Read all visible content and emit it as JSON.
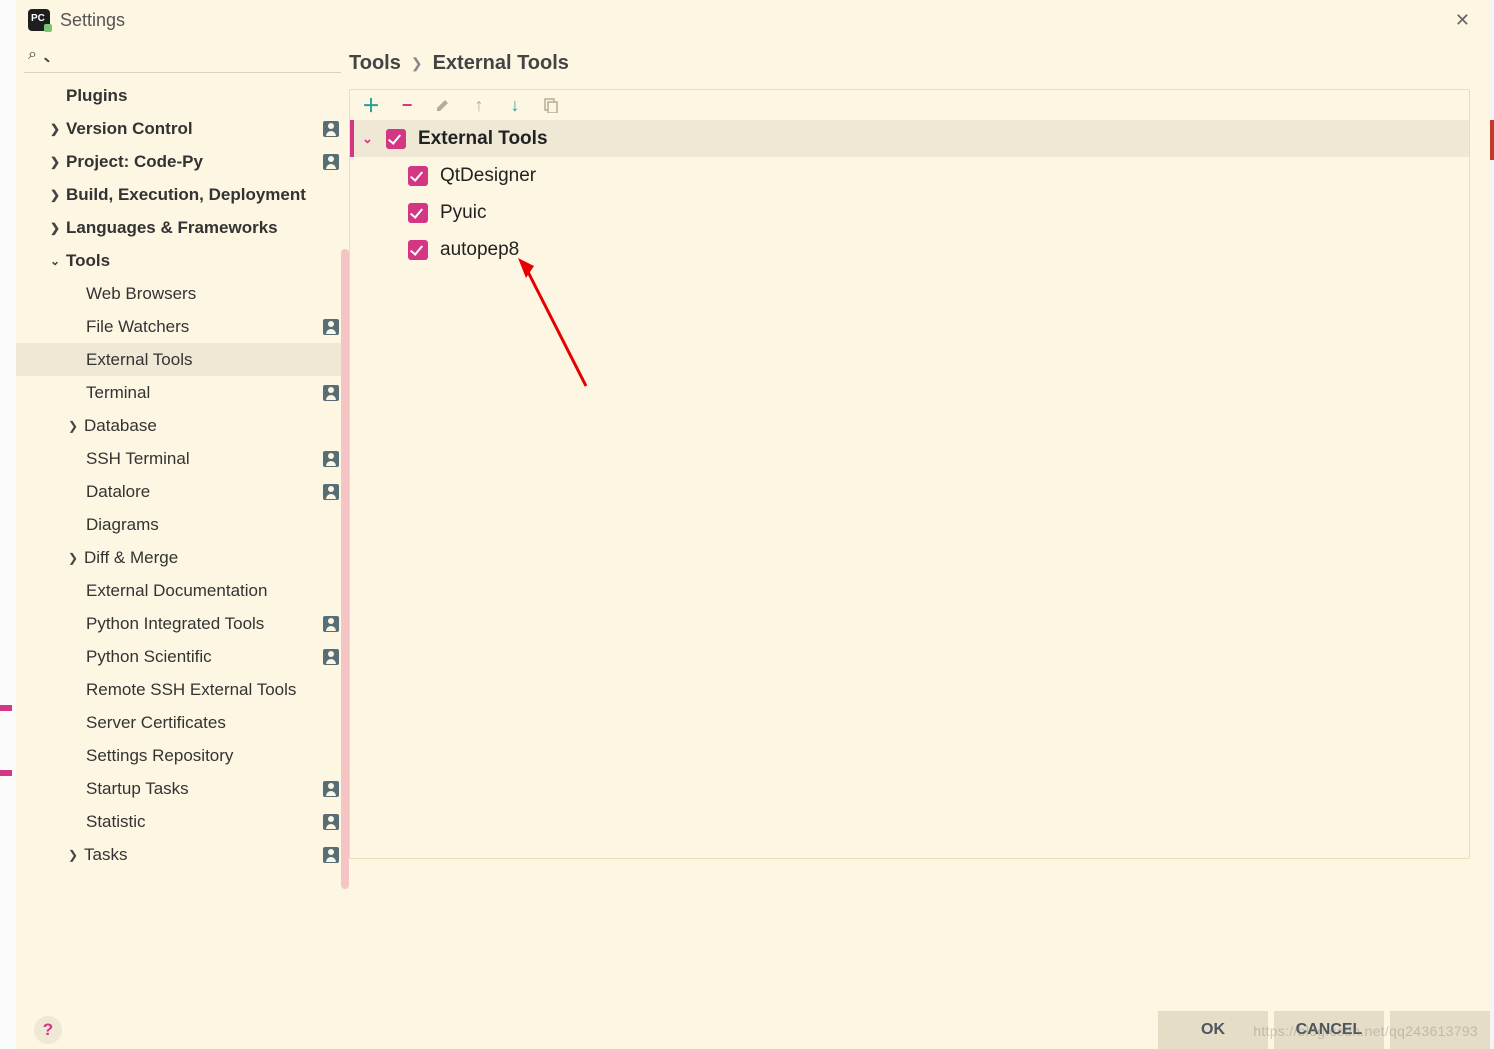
{
  "window": {
    "title": "Settings"
  },
  "breadcrumb": {
    "a": "Tools",
    "b": "External Tools"
  },
  "sidebar": {
    "items": [
      {
        "label": "Plugins"
      },
      {
        "label": "Version Control"
      },
      {
        "label": "Project: Code-Py"
      },
      {
        "label": "Build, Execution, Deployment"
      },
      {
        "label": "Languages & Frameworks"
      },
      {
        "label": "Tools"
      },
      {
        "label": "Web Browsers"
      },
      {
        "label": "File Watchers"
      },
      {
        "label": "External Tools"
      },
      {
        "label": "Terminal"
      },
      {
        "label": "Database"
      },
      {
        "label": "SSH Terminal"
      },
      {
        "label": "Datalore"
      },
      {
        "label": "Diagrams"
      },
      {
        "label": "Diff & Merge"
      },
      {
        "label": "External Documentation"
      },
      {
        "label": "Python Integrated Tools"
      },
      {
        "label": "Python Scientific"
      },
      {
        "label": "Remote SSH External Tools"
      },
      {
        "label": "Server Certificates"
      },
      {
        "label": "Settings Repository"
      },
      {
        "label": "Startup Tasks"
      },
      {
        "label": "Statistic"
      },
      {
        "label": "Tasks"
      }
    ]
  },
  "tools": {
    "group": "External Tools",
    "items": [
      {
        "label": "QtDesigner"
      },
      {
        "label": "Pyuic"
      },
      {
        "label": "autopep8"
      }
    ]
  },
  "buttons": {
    "ok": "OK",
    "cancel": "CANCEL"
  },
  "watermark": "https://blog.csdn.net/qq243613793"
}
